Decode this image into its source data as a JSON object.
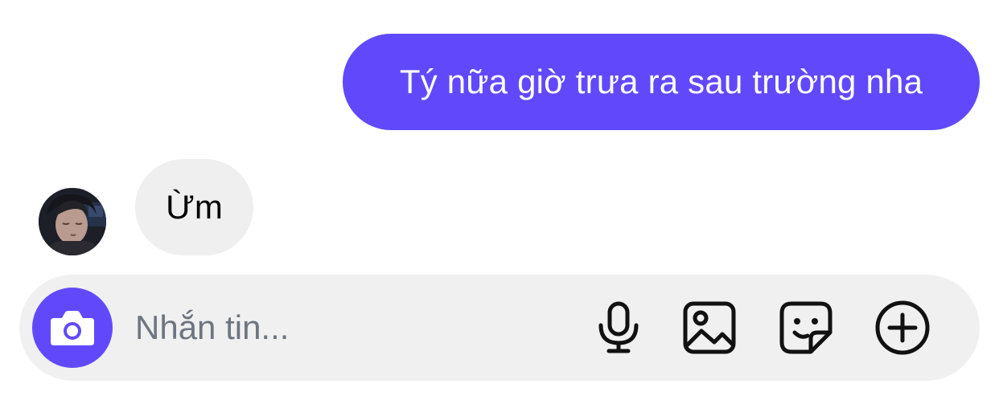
{
  "conversation": {
    "messages": [
      {
        "direction": "outgoing",
        "text": "Tý nữa giờ trưa ra sau trường nha"
      },
      {
        "direction": "incoming",
        "text": "Ừm"
      }
    ]
  },
  "composer": {
    "placeholder": "Nhắn tin...",
    "value": ""
  },
  "icons": {
    "camera": "camera-icon",
    "microphone": "microphone-icon",
    "gallery": "gallery-icon",
    "sticker": "sticker-icon",
    "add": "plus-circle-icon"
  },
  "colors": {
    "accent": "#6149fb",
    "incoming_bubble": "#efefef",
    "composer_bg": "#f0f0f0",
    "placeholder": "#6d7580",
    "icon": "#111111"
  }
}
